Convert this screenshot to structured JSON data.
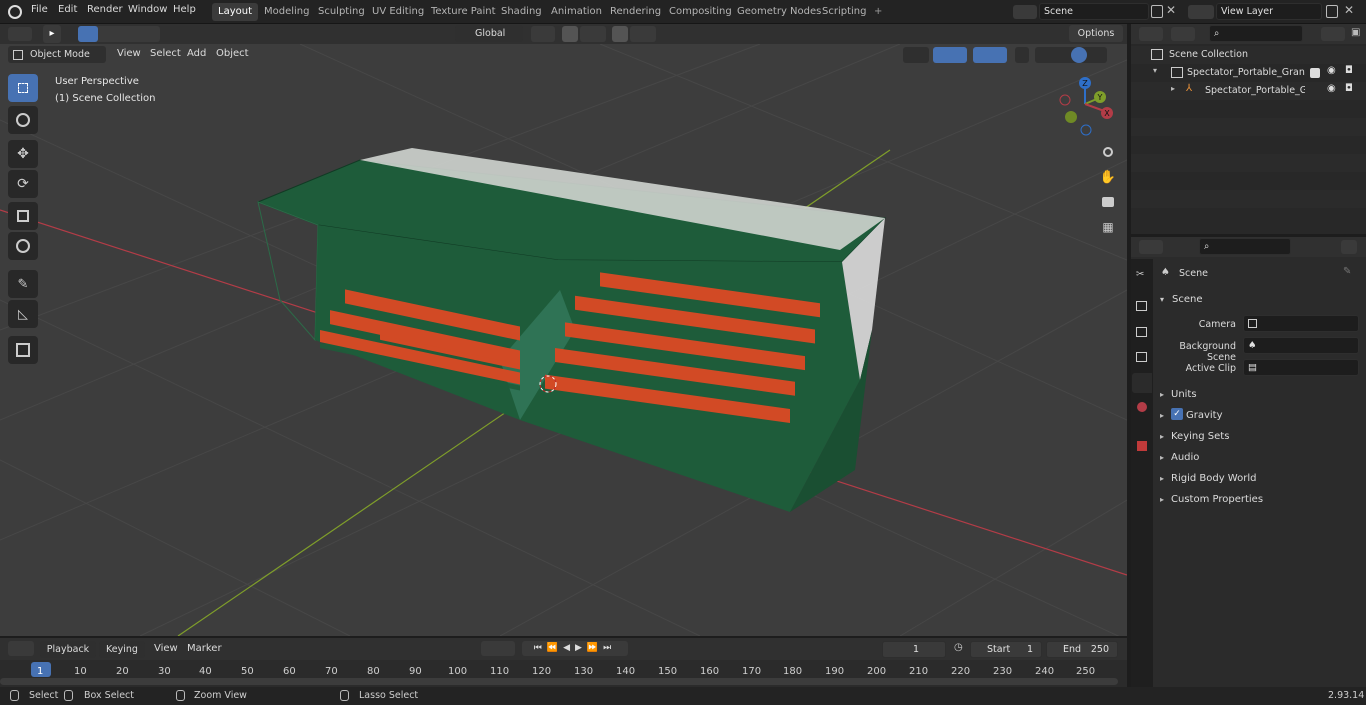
{
  "menu": {
    "file": "File",
    "edit": "Edit",
    "render": "Render",
    "window": "Window",
    "help": "Help"
  },
  "workspaces": [
    "Layout",
    "Modeling",
    "Sculpting",
    "UV Editing",
    "Texture Paint",
    "Shading",
    "Animation",
    "Rendering",
    "Compositing",
    "Geometry Nodes",
    "Scripting"
  ],
  "active_workspace": "Layout",
  "scene_field": "Scene",
  "view_layer_field": "View Layer",
  "viewport": {
    "mode": "Object Mode",
    "menus": [
      "View",
      "Select",
      "Add",
      "Object"
    ],
    "transform_orientation": "Global",
    "options_label": "Options",
    "info_line1": "User Perspective",
    "info_line2": "(1) Scene Collection",
    "gizmo_axes": {
      "z": "Z",
      "y": "Y",
      "x": "X"
    }
  },
  "outliner": {
    "root": "Scene Collection",
    "items": [
      {
        "label": "Spectator_Portable_Grandstand",
        "depth": 1
      },
      {
        "label": "Spectator_Portable_Gran",
        "depth": 2
      }
    ]
  },
  "properties": {
    "header": "Scene",
    "section": "Scene",
    "fields": [
      {
        "label": "Camera"
      },
      {
        "label": "Background Scene"
      },
      {
        "label": "Active Clip"
      }
    ],
    "panels": [
      "Units",
      "Gravity",
      "Keying Sets",
      "Audio",
      "Rigid Body World",
      "Custom Properties"
    ],
    "gravity_checked": true
  },
  "timeline": {
    "menus": [
      "Playback",
      "Keying",
      "View",
      "Marker"
    ],
    "current_frame": "1",
    "start_label": "Start",
    "start_value": "1",
    "end_label": "End",
    "end_value": "250",
    "ruler": [
      "1",
      "10",
      "20",
      "30",
      "40",
      "50",
      "60",
      "70",
      "80",
      "90",
      "100",
      "110",
      "120",
      "130",
      "140",
      "150",
      "160",
      "170",
      "180",
      "190",
      "200",
      "210",
      "220",
      "230",
      "240",
      "250"
    ]
  },
  "status": {
    "select": "Select",
    "box_select": "Box Select",
    "zoom_view": "Zoom View",
    "lasso_select": "Lasso Select",
    "version": "2.93.14"
  },
  "colors": {
    "accent": "#4772b3",
    "grandstand_green": "#1e5c3a",
    "seat_orange": "#d24a25",
    "x_axis": "#b33c47",
    "y_axis": "#7f9e2a"
  }
}
